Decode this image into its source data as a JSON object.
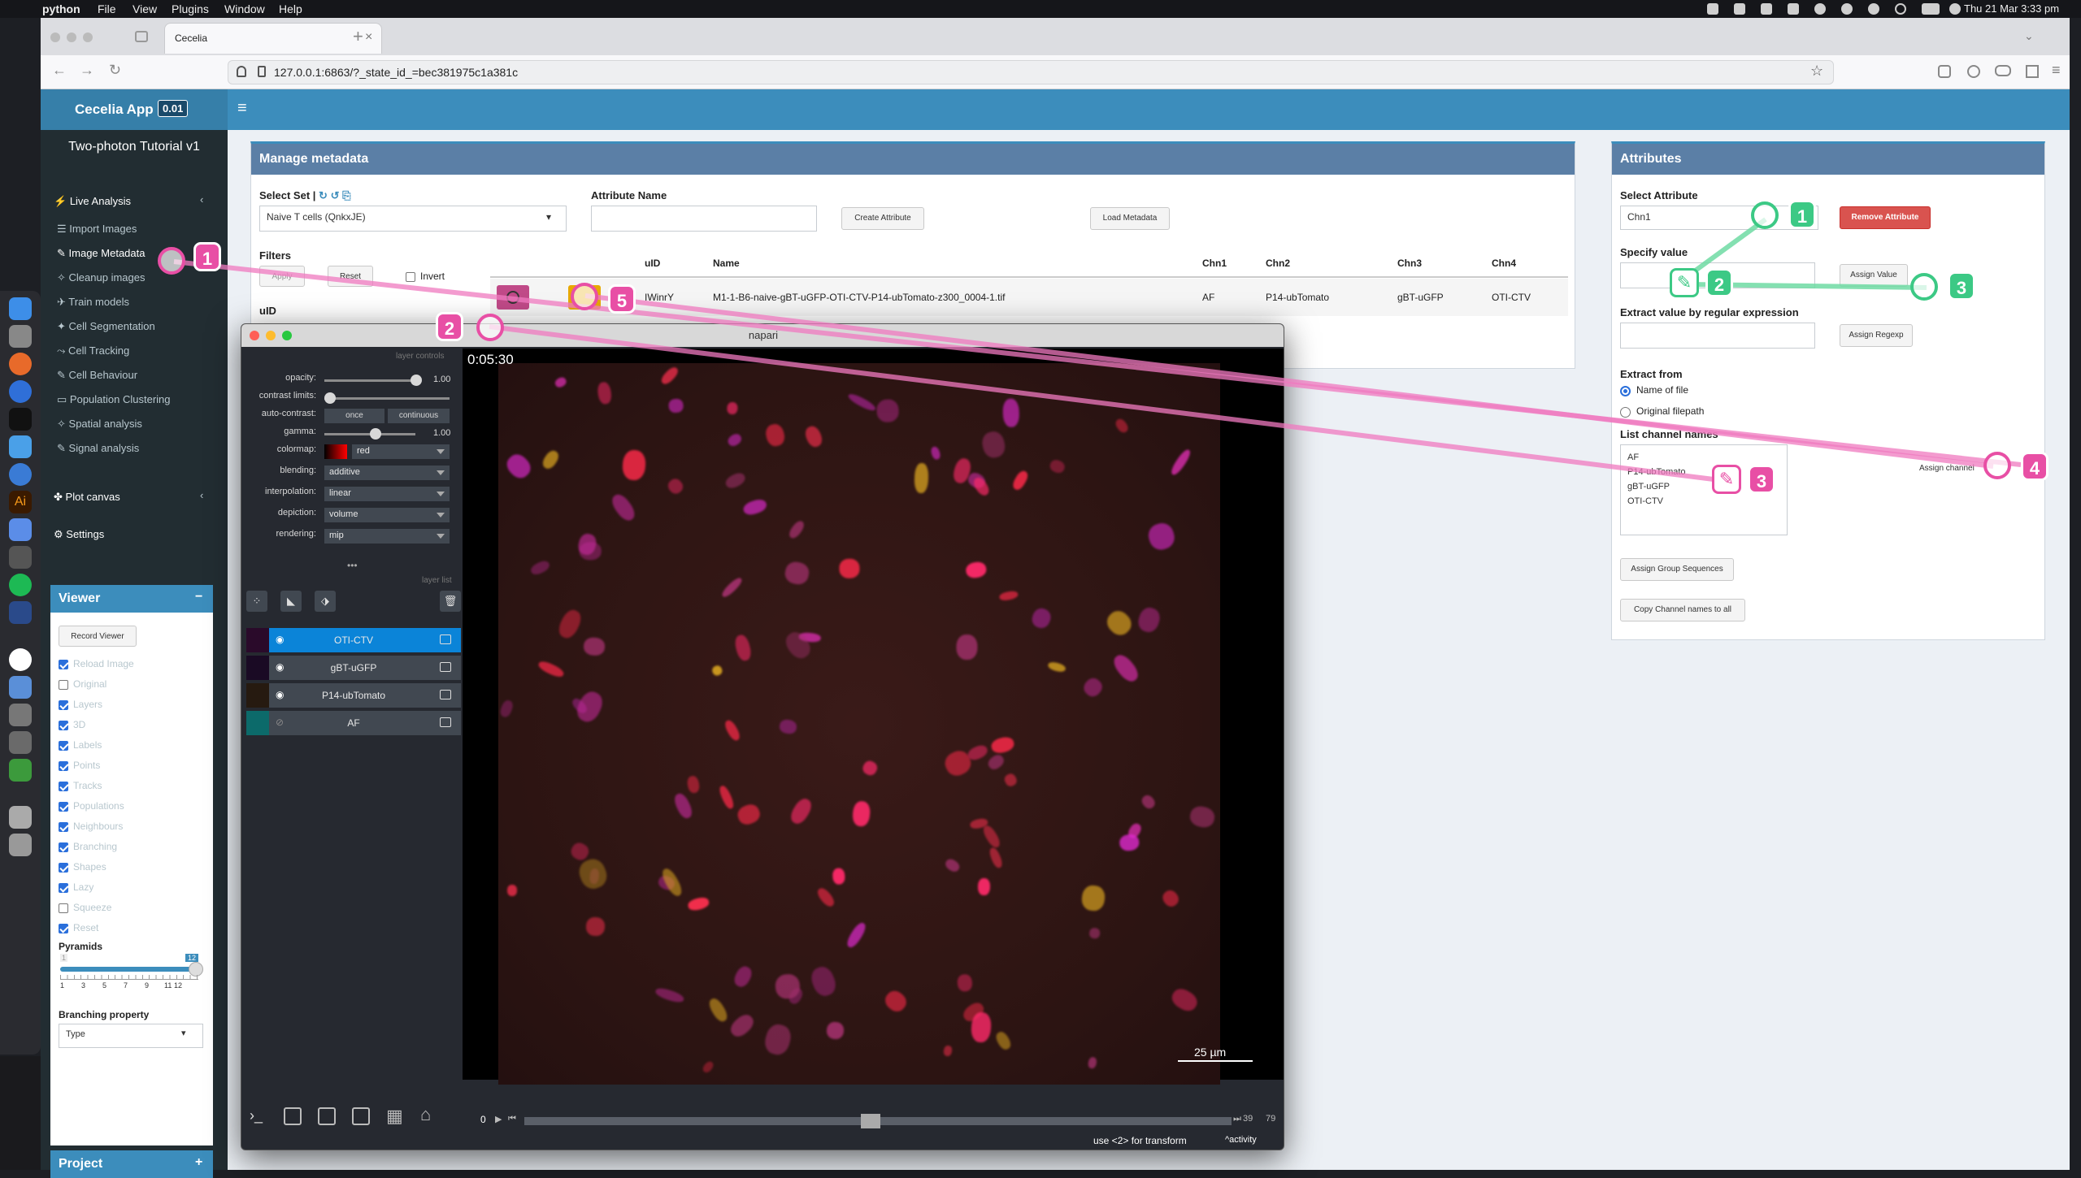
{
  "menubar": {
    "app": "python",
    "items": [
      "File",
      "View",
      "Plugins",
      "Window",
      "Help"
    ],
    "clock": "Thu 21 Mar  3:33 pm"
  },
  "browser": {
    "tab_title": "Cecelia",
    "url": "127.0.0.1:6863/?_state_id_=bec381975c1a381c"
  },
  "app": {
    "brand": "Cecelia App",
    "version": "0.01",
    "project_title": "Two-photon Tutorial v1",
    "sidebar": {
      "live_analysis": "Live Analysis",
      "items": [
        "Import Images",
        "Image Metadata",
        "Cleanup images",
        "Train models",
        "Cell Segmentation",
        "Cell Tracking",
        "Cell Behaviour",
        "Population Clustering",
        "Spatial analysis",
        "Signal analysis"
      ],
      "plot_canvas": "Plot canvas",
      "settings": "Settings"
    },
    "viewer": {
      "title": "Viewer",
      "collapse": "−",
      "record_button": "Record Viewer",
      "options": [
        {
          "label": "Reload Image",
          "checked": true
        },
        {
          "label": "Original",
          "checked": false
        },
        {
          "label": "Layers",
          "checked": true
        },
        {
          "label": "3D",
          "checked": true
        },
        {
          "label": "Labels",
          "checked": true
        },
        {
          "label": "Points",
          "checked": true
        },
        {
          "label": "Tracks",
          "checked": true
        },
        {
          "label": "Populations",
          "checked": true
        },
        {
          "label": "Neighbours",
          "checked": true
        },
        {
          "label": "Branching",
          "checked": true
        },
        {
          "label": "Shapes",
          "checked": true
        },
        {
          "label": "Lazy",
          "checked": true
        },
        {
          "label": "Squeeze",
          "checked": false
        },
        {
          "label": "Reset",
          "checked": true
        }
      ],
      "pyramids_label": "Pyramids",
      "pyramids_value": "12",
      "pyramids_min": "1",
      "pyramids_ticks": [
        "1",
        "3",
        "5",
        "7",
        "9",
        "11",
        "12"
      ],
      "branching_label": "Branching property",
      "branching_value": "Type"
    },
    "project": {
      "title": "Project",
      "expand": "+"
    },
    "manage": {
      "title": "Manage metadata",
      "select_set_label": "Select Set |",
      "select_set_value": "Naive T cells (QnkxJE)",
      "attribute_name_label": "Attribute Name",
      "create_attribute": "Create Attribute",
      "load_metadata": "Load Metadata",
      "filters_label": "Filters",
      "apply": "Apply",
      "reset": "Reset",
      "invert": "Invert",
      "uid_label": "uID",
      "table_headers": [
        "uID",
        "Name",
        "Chn1",
        "Chn2",
        "Chn3",
        "Chn4"
      ],
      "row": {
        "uid": "IWinrY",
        "name": "M1-1-B6-naive-gBT-uGFP-OTI-CTV-P14-ubTomato-z300_0004-1.tif",
        "chn1": "AF",
        "chn2": "P14-ubTomato",
        "chn3": "gBT-uGFP",
        "chn4": "OTI-CTV"
      }
    },
    "attributes": {
      "title": "Attributes",
      "select_attribute_label": "Select Attribute",
      "select_attribute_value": "Chn1",
      "remove_attribute": "Remove Attribute",
      "specify_value_label": "Specify value",
      "assign_value": "Assign Value",
      "regex_label": "Extract value by regular expression",
      "assign_regexp": "Assign Regexp",
      "extract_from_label": "Extract from",
      "extract_options": [
        {
          "label": "Name of file",
          "selected": true
        },
        {
          "label": "Original filepath",
          "selected": false
        }
      ],
      "list_channel_label": "List channel names",
      "channel_names": [
        "AF",
        "P14-ubTomato",
        "gBT-uGFP",
        "OTI-CTV"
      ],
      "assign_channel": "Assign channel",
      "assign_group_sequences": "Assign Group Sequences",
      "copy_channel_names": "Copy Channel names to all"
    }
  },
  "napari": {
    "title": "napari",
    "layer_controls_label": "layer controls",
    "layer_list_label": "layer list",
    "controls": {
      "opacity_label": "opacity:",
      "opacity_value": "1.00",
      "contrast_label": "contrast limits:",
      "auto_contrast_label": "auto-contrast:",
      "once": "once",
      "continuous": "continuous",
      "gamma_label": "gamma:",
      "gamma_value": "1.00",
      "colormap_label": "colormap:",
      "colormap_value": "red",
      "blending_label": "blending:",
      "blending_value": "additive",
      "interpolation_label": "interpolation:",
      "interpolation_value": "linear",
      "depiction_label": "depiction:",
      "depiction_value": "volume",
      "rendering_label": "rendering:",
      "rendering_value": "mip"
    },
    "layers": [
      {
        "name": "OTI-CTV",
        "selected": true,
        "visible": true,
        "color": "#2a0a2a"
      },
      {
        "name": "gBT-uGFP",
        "selected": false,
        "visible": true,
        "color": "#1a0a24"
      },
      {
        "name": "P14-ubTomato",
        "selected": false,
        "visible": true,
        "color": "#261a10"
      },
      {
        "name": "AF",
        "selected": false,
        "visible": false,
        "color": "#0c6a6a"
      }
    ],
    "timestamp": "0:05:30",
    "scale_bar": "25 µm",
    "slider_start": "0",
    "slider_value": "39",
    "slider_max": "79",
    "status": "use <2> for transform",
    "activity": "activity"
  },
  "annotations": {
    "pink": [
      "1",
      "2",
      "3",
      "4",
      "5"
    ],
    "green": [
      "1",
      "2",
      "3"
    ]
  },
  "colors": {
    "brand_blue": "#3c8dbc",
    "sidebar_bg": "#222d32",
    "remove_red": "#d9534f",
    "annotation_pink": "#e84fa5",
    "annotation_green": "#3cc985"
  }
}
